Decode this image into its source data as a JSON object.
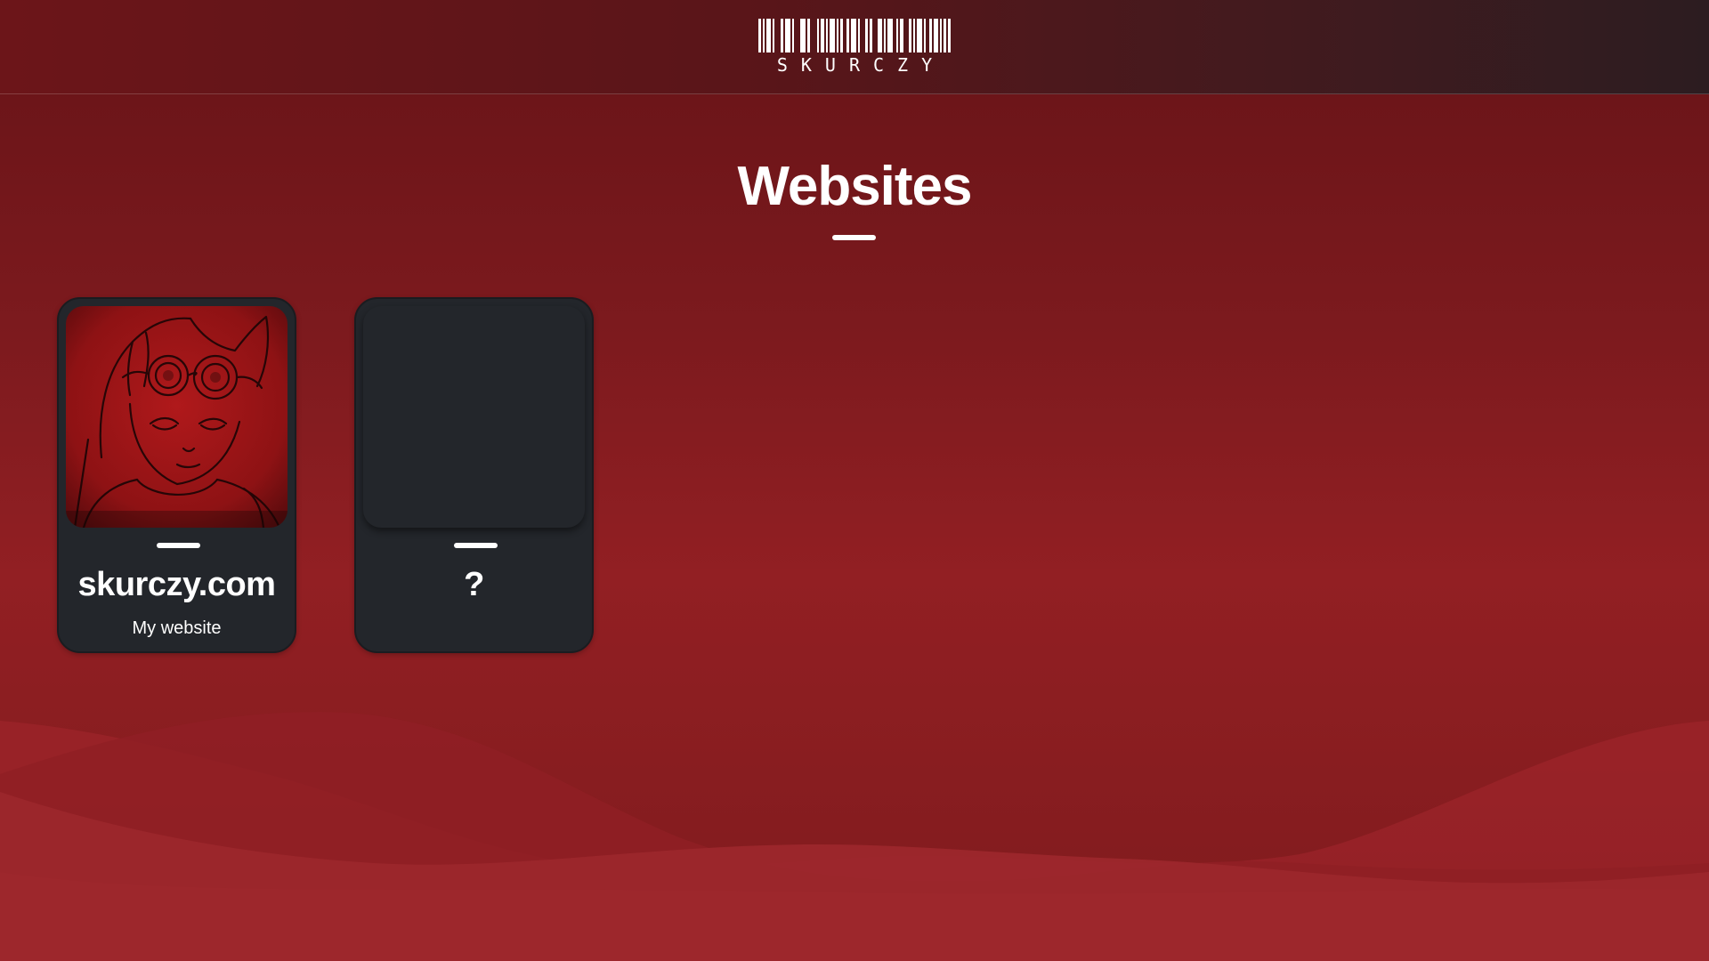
{
  "header": {
    "logo_text": "SKURCZY",
    "logo_name": "barcode-logo"
  },
  "main": {
    "title": "Websites"
  },
  "cards": [
    {
      "title": "skurczy.com",
      "subtitle": "My website",
      "image": "red-sketch-character-portrait"
    },
    {
      "title": "?",
      "subtitle": "",
      "image": ""
    }
  ],
  "colors": {
    "background": "#7d1a1e",
    "card": "#23262b",
    "text": "#ffffff",
    "accent": "#a4272d"
  }
}
